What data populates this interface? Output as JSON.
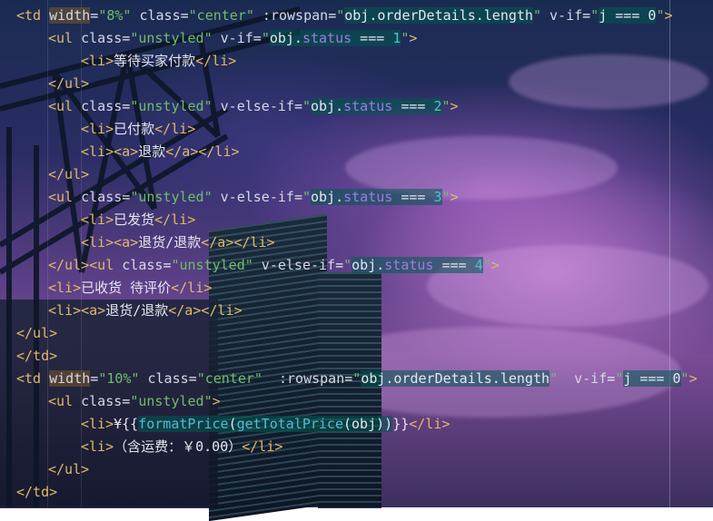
{
  "editor": {
    "lines": [
      {
        "indent": 0,
        "tokens": [
          {
            "t": "<td",
            "c": "tag"
          },
          {
            "t": " ",
            "c": "pl"
          },
          {
            "t": "width",
            "c": "attr hlo"
          },
          {
            "t": "=",
            "c": "pl"
          },
          {
            "t": "\"8%\"",
            "c": "str"
          },
          {
            "t": " class",
            "c": "attr"
          },
          {
            "t": "=",
            "c": "pl"
          },
          {
            "t": "\"center\"",
            "c": "str"
          },
          {
            "t": " :rowspan",
            "c": "attr"
          },
          {
            "t": "=",
            "c": "pl"
          },
          {
            "t": "\"",
            "c": "str"
          },
          {
            "t": "obj.orderDetails.length",
            "c": "pl hl"
          },
          {
            "t": "\"",
            "c": "str"
          },
          {
            "t": " v-if",
            "c": "attr"
          },
          {
            "t": "=",
            "c": "pl"
          },
          {
            "t": "\"",
            "c": "str"
          },
          {
            "t": "j === 0",
            "c": "pl hl"
          },
          {
            "t": "\"",
            "c": "str"
          },
          {
            "t": ">",
            "c": "tag"
          }
        ]
      },
      {
        "indent": 1,
        "tokens": [
          {
            "t": "<ul",
            "c": "tag"
          },
          {
            "t": " class",
            "c": "attr"
          },
          {
            "t": "=",
            "c": "pl"
          },
          {
            "t": "\"unstyled\"",
            "c": "str"
          },
          {
            "t": " v-if",
            "c": "attr"
          },
          {
            "t": "=",
            "c": "pl"
          },
          {
            "t": "\"",
            "c": "str"
          },
          {
            "t": "obj.",
            "c": "pl hl"
          },
          {
            "t": "status",
            "c": "prop hl"
          },
          {
            "t": " === ",
            "c": "pl hl"
          },
          {
            "t": "1",
            "c": "num hl"
          },
          {
            "t": "\"",
            "c": "str"
          },
          {
            "t": ">",
            "c": "tag"
          }
        ]
      },
      {
        "indent": 2,
        "tokens": [
          {
            "t": "<li>",
            "c": "tag"
          },
          {
            "t": "等待买家付款",
            "c": "pl"
          },
          {
            "t": "</li>",
            "c": "tag"
          }
        ]
      },
      {
        "indent": 1,
        "tokens": [
          {
            "t": "</ul>",
            "c": "tag"
          }
        ]
      },
      {
        "indent": 1,
        "tokens": [
          {
            "t": "<ul",
            "c": "tag"
          },
          {
            "t": " class",
            "c": "attr"
          },
          {
            "t": "=",
            "c": "pl"
          },
          {
            "t": "\"unstyled\"",
            "c": "str"
          },
          {
            "t": " v-else-if",
            "c": "attr"
          },
          {
            "t": "=",
            "c": "pl"
          },
          {
            "t": "\"",
            "c": "str"
          },
          {
            "t": "obj.",
            "c": "pl hl"
          },
          {
            "t": "status",
            "c": "prop hl"
          },
          {
            "t": " === ",
            "c": "pl hl"
          },
          {
            "t": "2",
            "c": "num hl"
          },
          {
            "t": "\"",
            "c": "str"
          },
          {
            "t": ">",
            "c": "tag"
          }
        ]
      },
      {
        "indent": 2,
        "tokens": [
          {
            "t": "<li>",
            "c": "tag"
          },
          {
            "t": "已付款",
            "c": "pl"
          },
          {
            "t": "</li>",
            "c": "tag"
          }
        ]
      },
      {
        "indent": 2,
        "tokens": [
          {
            "t": "<li><a>",
            "c": "tag"
          },
          {
            "t": "退款",
            "c": "pl"
          },
          {
            "t": "</a></li>",
            "c": "tag"
          }
        ]
      },
      {
        "indent": 1,
        "tokens": [
          {
            "t": "</ul>",
            "c": "tag"
          }
        ]
      },
      {
        "indent": 1,
        "tokens": [
          {
            "t": "<ul",
            "c": "tag"
          },
          {
            "t": " class",
            "c": "attr"
          },
          {
            "t": "=",
            "c": "pl"
          },
          {
            "t": "\"unstyled\"",
            "c": "str"
          },
          {
            "t": " v-else-if",
            "c": "attr"
          },
          {
            "t": "=",
            "c": "pl"
          },
          {
            "t": "\"",
            "c": "str"
          },
          {
            "t": "obj.",
            "c": "pl hl"
          },
          {
            "t": "status",
            "c": "prop hl"
          },
          {
            "t": " === ",
            "c": "pl hl"
          },
          {
            "t": "3",
            "c": "num hl"
          },
          {
            "t": "\"",
            "c": "str"
          },
          {
            "t": ">",
            "c": "tag"
          }
        ]
      },
      {
        "indent": 2,
        "tokens": [
          {
            "t": "<li>",
            "c": "tag"
          },
          {
            "t": "已发货",
            "c": "pl"
          },
          {
            "t": "</li>",
            "c": "tag"
          }
        ]
      },
      {
        "indent": 2,
        "tokens": [
          {
            "t": "<li><a>",
            "c": "tag"
          },
          {
            "t": "退货/退款",
            "c": "pl"
          },
          {
            "t": "</a></li>",
            "c": "tag"
          }
        ]
      },
      {
        "indent": 1,
        "tokens": [
          {
            "t": "</ul><ul",
            "c": "tag"
          },
          {
            "t": " class",
            "c": "attr"
          },
          {
            "t": "=",
            "c": "pl"
          },
          {
            "t": "\"unstyled\"",
            "c": "str"
          },
          {
            "t": " v-else-if",
            "c": "attr"
          },
          {
            "t": "=",
            "c": "pl"
          },
          {
            "t": "\"",
            "c": "str"
          },
          {
            "t": "obj.",
            "c": "pl hl"
          },
          {
            "t": "status",
            "c": "prop hl"
          },
          {
            "t": " === ",
            "c": "pl hl"
          },
          {
            "t": "4",
            "c": "num hl"
          },
          {
            "t": "\"",
            "c": "str"
          },
          {
            "t": ">",
            "c": "tag"
          }
        ]
      },
      {
        "indent": 1,
        "tokens": [
          {
            "t": "<li>",
            "c": "tag"
          },
          {
            "t": "已收货 待评价",
            "c": "pl"
          },
          {
            "t": "</li>",
            "c": "tag"
          }
        ]
      },
      {
        "indent": 1,
        "tokens": [
          {
            "t": "<li><a>",
            "c": "tag"
          },
          {
            "t": "退货/退款",
            "c": "pl"
          },
          {
            "t": "</a></li>",
            "c": "tag"
          }
        ]
      },
      {
        "indent": 0,
        "tokens": [
          {
            "t": "</ul>",
            "c": "tag"
          }
        ]
      },
      {
        "indent": 0,
        "tokens": [
          {
            "t": "</td>",
            "c": "tag"
          }
        ]
      },
      {
        "indent": 0,
        "tokens": [
          {
            "t": "<td",
            "c": "tag"
          },
          {
            "t": " ",
            "c": "pl"
          },
          {
            "t": "width",
            "c": "attr hlo"
          },
          {
            "t": "=",
            "c": "pl"
          },
          {
            "t": "\"10%\"",
            "c": "str"
          },
          {
            "t": " class",
            "c": "attr"
          },
          {
            "t": "=",
            "c": "pl"
          },
          {
            "t": "\"center\"",
            "c": "str"
          },
          {
            "t": "  :rowspan",
            "c": "attr"
          },
          {
            "t": "=",
            "c": "pl"
          },
          {
            "t": "\"",
            "c": "str"
          },
          {
            "t": "obj.orderDetails.length",
            "c": "pl hl"
          },
          {
            "t": "\"",
            "c": "str"
          },
          {
            "t": "  v-if",
            "c": "attr"
          },
          {
            "t": "=",
            "c": "pl"
          },
          {
            "t": "\"",
            "c": "str"
          },
          {
            "t": "j === 0",
            "c": "pl hl"
          },
          {
            "t": "\"",
            "c": "str"
          },
          {
            "t": ">",
            "c": "tag"
          }
        ]
      },
      {
        "indent": 1,
        "tokens": [
          {
            "t": "<ul",
            "c": "tag"
          },
          {
            "t": " class",
            "c": "attr"
          },
          {
            "t": "=",
            "c": "pl"
          },
          {
            "t": "\"unstyled\"",
            "c": "str"
          },
          {
            "t": ">",
            "c": "tag"
          }
        ]
      },
      {
        "indent": 2,
        "tokens": [
          {
            "t": "<li>",
            "c": "tag"
          },
          {
            "t": "¥{{",
            "c": "pl"
          },
          {
            "t": "formatPrice",
            "c": "fn hl"
          },
          {
            "t": "(",
            "c": "pl hl"
          },
          {
            "t": "getTotalPrice",
            "c": "fn hl"
          },
          {
            "t": "(obj))",
            "c": "pl hl"
          },
          {
            "t": "}}",
            "c": "pl"
          },
          {
            "t": "</li>",
            "c": "tag"
          }
        ]
      },
      {
        "indent": 2,
        "tokens": [
          {
            "t": "<li>",
            "c": "tag"
          },
          {
            "t": "（含运费：￥0.00）",
            "c": "pl"
          },
          {
            "t": "</li>",
            "c": "tag"
          }
        ]
      },
      {
        "indent": 1,
        "tokens": [
          {
            "t": "</ul>",
            "c": "tag"
          }
        ]
      },
      {
        "indent": 0,
        "tokens": [
          {
            "t": "</td>",
            "c": "tag"
          }
        ]
      }
    ]
  }
}
